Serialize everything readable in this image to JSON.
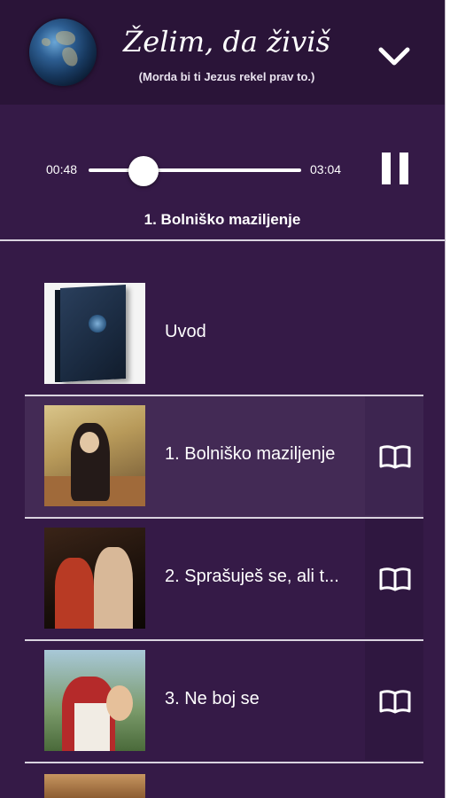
{
  "header": {
    "title": "Želim, da živiš",
    "subtitle": "(Morda bi ti Jezus rekel prav to.)"
  },
  "player": {
    "current_time": "00:48",
    "duration": "03:04",
    "progress": 0.26,
    "now_playing": "1. Bolniško maziljenje"
  },
  "tracks": [
    {
      "label": "Uvod",
      "thumbnail": "book-cover-image",
      "has_text": false,
      "active": false
    },
    {
      "label": "1. Bolniško maziljenje",
      "thumbnail": "nun-painting-image",
      "has_text": true,
      "active": true
    },
    {
      "label": "2. Sprašuješ se, ali t...",
      "thumbnail": "thomas-painting-image",
      "has_text": true,
      "active": false
    },
    {
      "label": "3. Ne boj se",
      "thumbnail": "jesus-child-painting-image",
      "has_text": true,
      "active": false
    }
  ],
  "icons": {
    "collapse": "chevron-down-icon",
    "pause": "pause-icon",
    "text": "open-book-icon"
  },
  "colors": {
    "background": "#351a47",
    "header": "#2a1438",
    "active_row": "#432a55"
  }
}
